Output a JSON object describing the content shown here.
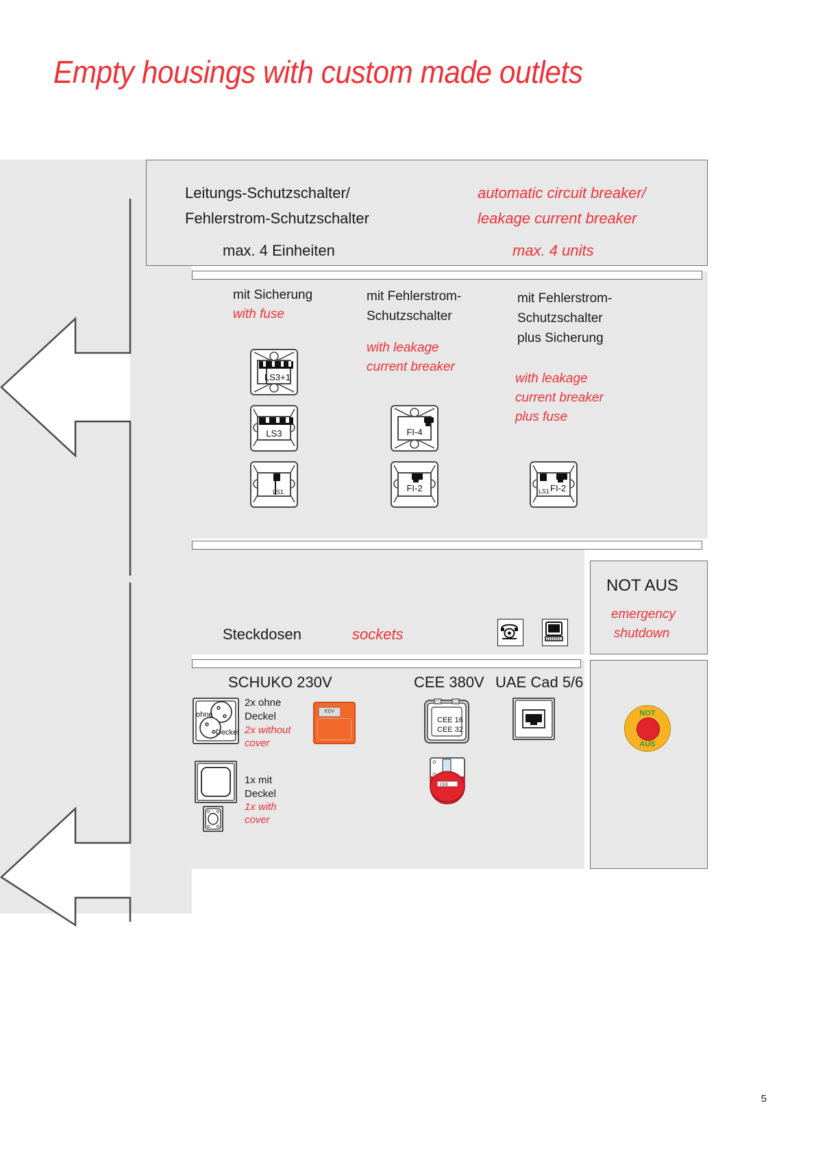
{
  "page": {
    "title": "Empty housings with custom made outlets",
    "number": "5"
  },
  "breaker_section": {
    "heading_de_line1": "Leitungs-Schutzschalter/",
    "heading_de_line2": "Fehlerstrom-Schutzschalter",
    "heading_en_line1": "automatic circuit breaker/",
    "heading_en_line2": "leakage current breaker",
    "subheading_de": "max. 4 Einheiten",
    "subheading_en": "max. 4 units",
    "columns": [
      {
        "de": "mit Sicherung",
        "en": "with fuse",
        "devices": [
          {
            "label": "LS3+1"
          },
          {
            "label": "LS3"
          },
          {
            "label": "LS1"
          }
        ]
      },
      {
        "de_line1": "mit Fehlerstrom-",
        "de_line2": "Schutzschalter",
        "en_line1": "with leakage",
        "en_line2": "current breaker",
        "devices": [
          {
            "label": "FI-4"
          },
          {
            "label": "FI-2"
          }
        ]
      },
      {
        "de_line1": "mit Fehlerstrom-",
        "de_line2": "Schutzschalter",
        "de_line3": "plus Sicherung",
        "en_line1": "with leakage",
        "en_line2": "current breaker",
        "en_line3": "plus fuse",
        "devices": [
          {
            "label_small": "LS1",
            "label": "FI-2"
          }
        ]
      }
    ]
  },
  "sockets_section": {
    "heading_de": "Steckdosen",
    "heading_en": "sockets",
    "icons": [
      {
        "name": "telephone-icon"
      },
      {
        "name": "computer-icon"
      }
    ],
    "groups": [
      {
        "title": "SCHUKO 230V",
        "items": [
          {
            "de_line1": "2x ohne",
            "de_line2": "Deckel",
            "en_line1": "2x without",
            "en_line2": "cover",
            "icon_label_1": "ohne",
            "icon_label_2": "Deckel"
          },
          {
            "de_line1": "1x mit",
            "de_line2": "Deckel",
            "en_line1": "1x with",
            "en_line2": "cover"
          }
        ],
        "edv_label": "EDV"
      },
      {
        "title": "CEE 380V",
        "cee_line1": "CEE 16",
        "cee_line2": "CEE 32",
        "plug_label": "CEE"
      },
      {
        "title": "UAE Cad 5/6"
      }
    ]
  },
  "emergency_section": {
    "heading_de": "NOT AUS",
    "heading_en_line1": "emergency",
    "heading_en_line2": "shutdown",
    "button_line1": "NOT",
    "button_line2": "AUS"
  },
  "colors": {
    "accent_red": "#ed3237",
    "panel_grey": "#e8e8e8",
    "orange": "#f2682a",
    "yellow": "#f5b323",
    "green": "#2f9e44"
  }
}
